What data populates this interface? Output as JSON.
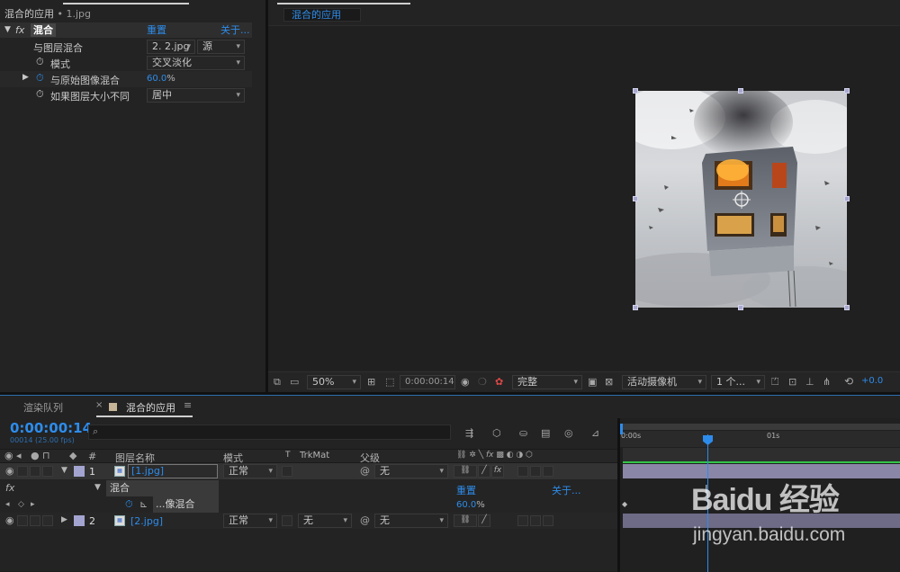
{
  "effect_controls": {
    "tab_title": "混合的应用",
    "file_name": "1.jpg",
    "fx_label": "fx",
    "effect_name": "混合",
    "reset_label": "重置",
    "about_label": "关于...",
    "params": {
      "blend_layer": {
        "label": "与图层混合",
        "value": "2. 2.jpg",
        "source": "源"
      },
      "mode": {
        "label": "模式",
        "value": "交叉淡化"
      },
      "blend_original": {
        "label": "与原始图像混合",
        "value": "60.0",
        "unit": "%"
      },
      "size_mismatch": {
        "label": "如果图层大小不同",
        "value": "居中"
      }
    }
  },
  "composition": {
    "tab_title": "混合的应用",
    "toolbar": {
      "zoom": "50%",
      "timecode": "0:00:00:14",
      "resolution": "完整",
      "camera": "活动摄像机",
      "views": "1 个...",
      "exposure": "+0.0"
    }
  },
  "timeline": {
    "tab_render_queue": "渲染队列",
    "tab_comp": "混合的应用",
    "current_time": "0:00:00:14",
    "frame_info": "00014 (25.00 fps)",
    "search_placeholder": "",
    "headers": {
      "num": "#",
      "name": "图层名称",
      "mode": "模式",
      "t": "T",
      "trkmat": "TrkMat",
      "parent": "父级"
    },
    "ruler": {
      "start": "0:00s",
      "mark": "01s"
    },
    "layers": [
      {
        "num": "1",
        "name": "[1.jpg]",
        "mode": "正常",
        "trkmat": "",
        "parent": "无"
      },
      {
        "num": "2",
        "name": "[2.jpg]",
        "mode": "正常",
        "trkmat": "无",
        "parent": "无"
      }
    ],
    "effect_row": {
      "fx": "fx",
      "name": "混合",
      "reset": "重置",
      "about": "关于..."
    },
    "param_row": {
      "name": "...像混合",
      "value": "60.0",
      "unit": "%"
    }
  },
  "watermark": {
    "brand": "Baidu 经验",
    "url": "jingyan.baidu.com"
  },
  "colors": {
    "accent": "#2d8ceb",
    "layer_label": "#a4a4d0",
    "bar": "#8a86a8",
    "cti": "#2d8ceb"
  }
}
